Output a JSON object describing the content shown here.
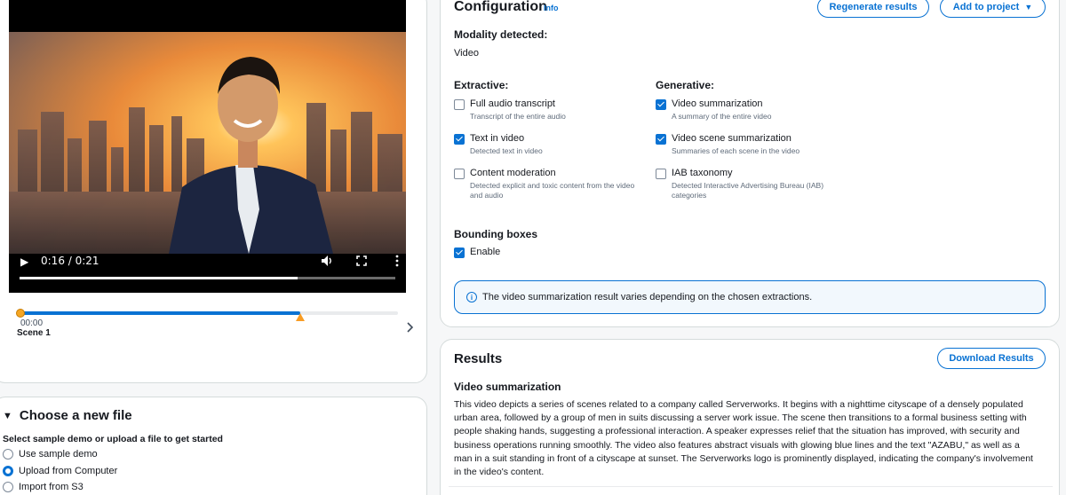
{
  "video": {
    "time": "0:16 / 0:21",
    "progress": 0.74
  },
  "timeline": {
    "progress": 0.74,
    "start_time": "00:00",
    "scene_label": "Scene 1"
  },
  "choose": {
    "title": "Choose a new file",
    "subtitle": "Select sample demo or upload a file to get started",
    "options": [
      {
        "label": "Use sample demo",
        "selected": false
      },
      {
        "label": "Upload from Computer",
        "selected": true
      },
      {
        "label": "Import from S3",
        "selected": false
      }
    ]
  },
  "configuration": {
    "title": "Configuration",
    "info": "Info",
    "regenerate_label": "Regenerate results",
    "add_to_project_label": "Add to project",
    "modality_label": "Modality detected:",
    "modality_value": "Video",
    "extractive_label": "Extractive:",
    "generative_label": "Generative:",
    "extractive": [
      {
        "title": "Full audio transcript",
        "desc": "Transcript of the entire audio",
        "checked": false
      },
      {
        "title": "Text in video",
        "desc": "Detected text in video",
        "checked": true
      },
      {
        "title": "Content moderation",
        "desc": "Detected explicit and toxic content from the video and audio",
        "checked": false
      }
    ],
    "generative": [
      {
        "title": "Video summarization",
        "desc": "A summary of the entire video",
        "checked": true
      },
      {
        "title": "Video scene summarization",
        "desc": "Summaries of each scene in the video",
        "checked": true
      },
      {
        "title": "IAB taxonomy",
        "desc": "Detected Interactive Advertising Bureau (IAB) categories",
        "checked": false
      }
    ],
    "bbox_label": "Bounding boxes",
    "bbox_enable": "Enable",
    "bbox_checked": true,
    "alert": "The video summarization result varies depending on the chosen extractions."
  },
  "results": {
    "title": "Results",
    "download_label": "Download Results",
    "section_title": "Video summarization",
    "summary": "This video depicts a series of scenes related to a company called Serverworks. It begins with a nighttime cityscape of a densely populated urban area, followed by a group of men in suits discussing a server work issue. The scene then transitions to a formal business setting with people shaking hands, suggesting a professional interaction. A speaker expresses relief that the situation has improved, with security and business operations running smoothly. The video also features abstract visuals with glowing blue lines and the text \"AZABU,\" as well as a man in a suit standing in front of a cityscape at sunset. The Serverworks logo is prominently displayed, indicating the company's involvement in the video's content."
  },
  "colors": {
    "accent": "#0972d3",
    "marker": "#f89c24"
  }
}
